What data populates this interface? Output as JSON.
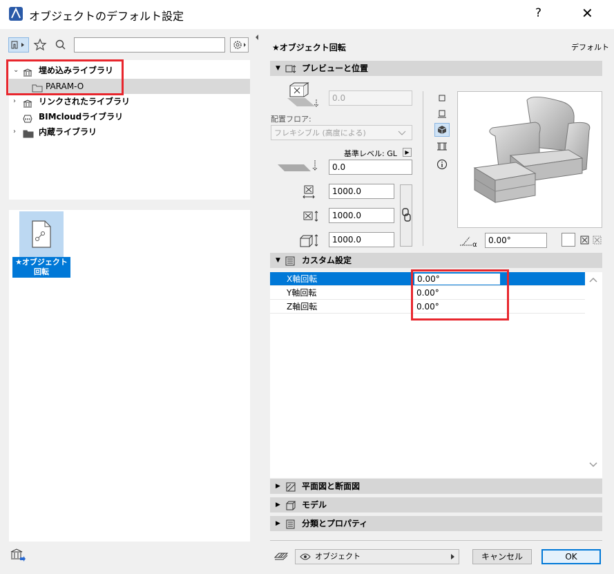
{
  "window": {
    "title": "オブジェクトのデフォルト設定",
    "help": "?",
    "close": "✕"
  },
  "library_tree": {
    "items": [
      {
        "label": "埋め込みライブラリ",
        "chevron": "⌄"
      },
      {
        "label": "PARAM-O"
      },
      {
        "label": "リンクされたライブラリ",
        "chevron": "›"
      },
      {
        "label": "BIMcloudライブラリ"
      },
      {
        "label": "内蔵ライブラリ",
        "chevron": "›"
      }
    ]
  },
  "search": {
    "value": ""
  },
  "object_tile": {
    "label": "★オブジェクト回転"
  },
  "settings": {
    "object_title": "★オブジェクト回転",
    "default_label": "デフォルト",
    "sections": {
      "preview": "プレビューと位置",
      "custom": "カスタム設定",
      "plan": "平面図と断面図",
      "model": "モデル",
      "classification": "分類とプロパティ"
    },
    "elevation_value": "0.0",
    "placement_floor_label": "配置フロア:",
    "placement_floor_value": "フレキシブル (高度による)",
    "reference_level": "基準レベル: GL",
    "offset_value": "0.0",
    "width_value": "1000.0",
    "depth_value": "1000.0",
    "height_value": "1000.0",
    "rotation_value": "0.00°"
  },
  "params": [
    {
      "name": "X軸回転",
      "value": "0.00°"
    },
    {
      "name": "Y軸回転",
      "value": "0.00°"
    },
    {
      "name": "Z軸回転",
      "value": "0.00°"
    }
  ],
  "footer": {
    "layer_value": "オブジェクト",
    "cancel_label": "キャンセル",
    "ok_label": "OK"
  },
  "colors": {
    "accent": "#0078d7",
    "highlight_box": "#e8262d",
    "section_header": "#d6d6d6"
  }
}
